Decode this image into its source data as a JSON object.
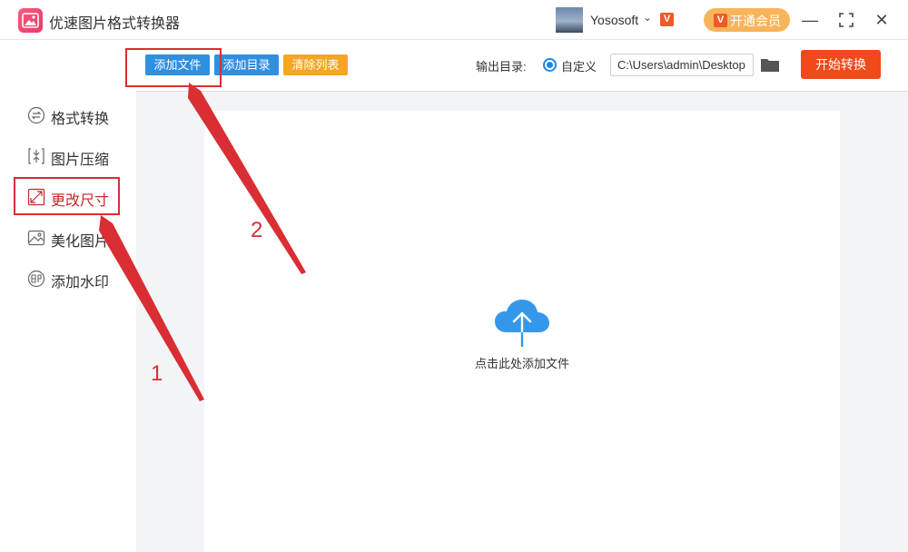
{
  "app": {
    "title": "优速图片格式转换器",
    "logo_icon": "image-icon"
  },
  "user": {
    "name": "Yososoft",
    "vip_mark": "V",
    "vip_button_label": "开通会员"
  },
  "window_controls": {
    "minimize": "—",
    "maximize": "⛶",
    "close": "✕"
  },
  "sidebar": {
    "items": [
      {
        "label": "格式转换",
        "icon": "format-convert-icon",
        "active": false
      },
      {
        "label": "图片压缩",
        "icon": "compress-icon",
        "active": false
      },
      {
        "label": "更改尺寸",
        "icon": "resize-icon",
        "active": true
      },
      {
        "label": "美化图片",
        "icon": "beautify-icon",
        "active": false
      },
      {
        "label": "添加水印",
        "icon": "watermark-icon",
        "active": false
      }
    ]
  },
  "toolbar": {
    "add_file": "添加文件",
    "add_dir": "添加目录",
    "clear_list": "清除列表",
    "output_label": "输出目录:",
    "custom_label": "自定义",
    "output_path": "C:\\Users\\admin\\Desktop",
    "start_button": "开始转换"
  },
  "dropzone": {
    "hint": "点击此处添加文件",
    "icon": "cloud-upload-icon"
  },
  "annotations": {
    "step1": "1",
    "step2": "2"
  },
  "colors": {
    "accent_blue": "#2f8fe0",
    "clear_orange": "#f6a623",
    "start_red": "#f04a1b",
    "vip_orange": "#f8b45a",
    "annotation_red": "#d92e33",
    "active_nav": "#c6272c"
  }
}
